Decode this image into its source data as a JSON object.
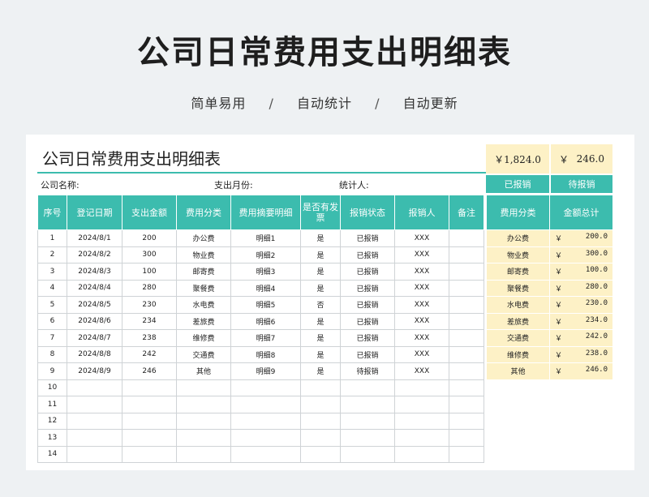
{
  "hero": {
    "title": "公司日常费用支出明细表",
    "subtitle": [
      "简单易用",
      "自动统计",
      "自动更新"
    ],
    "separator": "/"
  },
  "sheet": {
    "title": "公司日常费用支出明细表",
    "company_label": "公司名称:",
    "month_label": "支出月份:",
    "stat_label": "统计人:",
    "total_reimbursed": "￥1,824.0",
    "total_pending_symbol": "￥",
    "total_pending": "246.0",
    "reimbursed_button": "已报销",
    "pending_button": "待报销"
  },
  "table": {
    "headers": [
      "序号",
      "登记日期",
      "支出金额",
      "费用分类",
      "费用摘要明细",
      "是否有发票",
      "报销状态",
      "报销人",
      "备注"
    ],
    "rows": [
      [
        "1",
        "2024/8/1",
        "200",
        "办公费",
        "明细1",
        "是",
        "已报销",
        "XXX",
        ""
      ],
      [
        "2",
        "2024/8/2",
        "300",
        "物业费",
        "明细2",
        "是",
        "已报销",
        "XXX",
        ""
      ],
      [
        "3",
        "2024/8/3",
        "100",
        "邮寄费",
        "明细3",
        "是",
        "已报销",
        "XXX",
        ""
      ],
      [
        "4",
        "2024/8/4",
        "280",
        "聚餐费",
        "明细4",
        "是",
        "已报销",
        "XXX",
        ""
      ],
      [
        "5",
        "2024/8/5",
        "230",
        "水电费",
        "明细5",
        "否",
        "已报销",
        "XXX",
        ""
      ],
      [
        "6",
        "2024/8/6",
        "234",
        "差旅费",
        "明细6",
        "是",
        "已报销",
        "XXX",
        ""
      ],
      [
        "7",
        "2024/8/7",
        "238",
        "维修费",
        "明细7",
        "是",
        "已报销",
        "XXX",
        ""
      ],
      [
        "8",
        "2024/8/8",
        "242",
        "交通费",
        "明细8",
        "是",
        "已报销",
        "XXX",
        ""
      ],
      [
        "9",
        "2024/8/9",
        "246",
        "其他",
        "明细9",
        "是",
        "待报销",
        "XXX",
        ""
      ],
      [
        "10",
        "",
        "",
        "",
        "",
        "",
        "",
        "",
        ""
      ],
      [
        "11",
        "",
        "",
        "",
        "",
        "",
        "",
        "",
        ""
      ],
      [
        "12",
        "",
        "",
        "",
        "",
        "",
        "",
        "",
        ""
      ],
      [
        "13",
        "",
        "",
        "",
        "",
        "",
        "",
        "",
        ""
      ],
      [
        "14",
        "",
        "",
        "",
        "",
        "",
        "",
        "",
        ""
      ]
    ]
  },
  "summary": {
    "headers": [
      "费用分类",
      "金额总计"
    ],
    "currency": "￥",
    "rows": [
      [
        "办公费",
        "200.0"
      ],
      [
        "物业费",
        "300.0"
      ],
      [
        "邮寄费",
        "100.0"
      ],
      [
        "聚餐费",
        "280.0"
      ],
      [
        "水电费",
        "230.0"
      ],
      [
        "差旅费",
        "234.0"
      ],
      [
        "交通费",
        "242.0"
      ],
      [
        "维修费",
        "238.0"
      ],
      [
        "其他",
        "246.0"
      ]
    ]
  },
  "colors": {
    "accent": "#3cbcae",
    "highlight": "#fdf1c6",
    "background": "#eef1f3"
  }
}
